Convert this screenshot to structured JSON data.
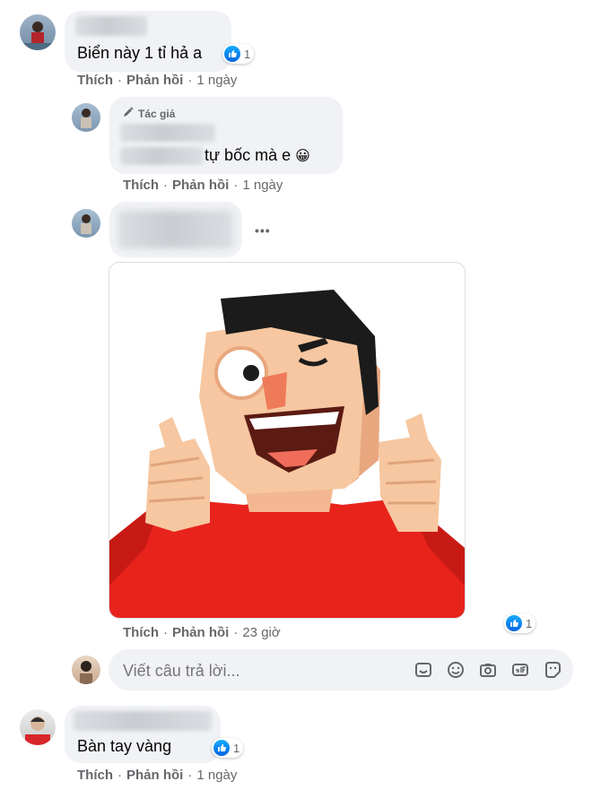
{
  "comments": [
    {
      "text": "Biển này 1 tỉ hả a",
      "reaction_count": "1",
      "actions": {
        "like": "Thích",
        "reply": "Phản hồi",
        "time": "1 ngày"
      }
    },
    {
      "author_badge": "Tác giả",
      "text": "tự bốc mà e",
      "emoji": "😀",
      "actions": {
        "like": "Thích",
        "reply": "Phản hồi",
        "time": "1 ngày"
      }
    },
    {
      "options_label": "•••",
      "reaction_count": "1",
      "actions": {
        "like": "Thích",
        "reply": "Phản hồi",
        "time": "23 giờ"
      }
    },
    {
      "text": "Bàn tay vàng",
      "reaction_count": "1",
      "actions": {
        "like": "Thích",
        "reply": "Phản hồi",
        "time": "1 ngày"
      }
    }
  ],
  "reply_box": {
    "placeholder": "Viết câu trả lời...",
    "tools": [
      "sticker-icon",
      "emoji-icon",
      "camera-icon",
      "gif-icon",
      "avatar-sticker-icon"
    ]
  },
  "colors": {
    "bubble": "#f0f2f5",
    "meta_text": "#65676b",
    "like_blue": "#0866ff",
    "sticker_shirt": "#e8231c"
  }
}
